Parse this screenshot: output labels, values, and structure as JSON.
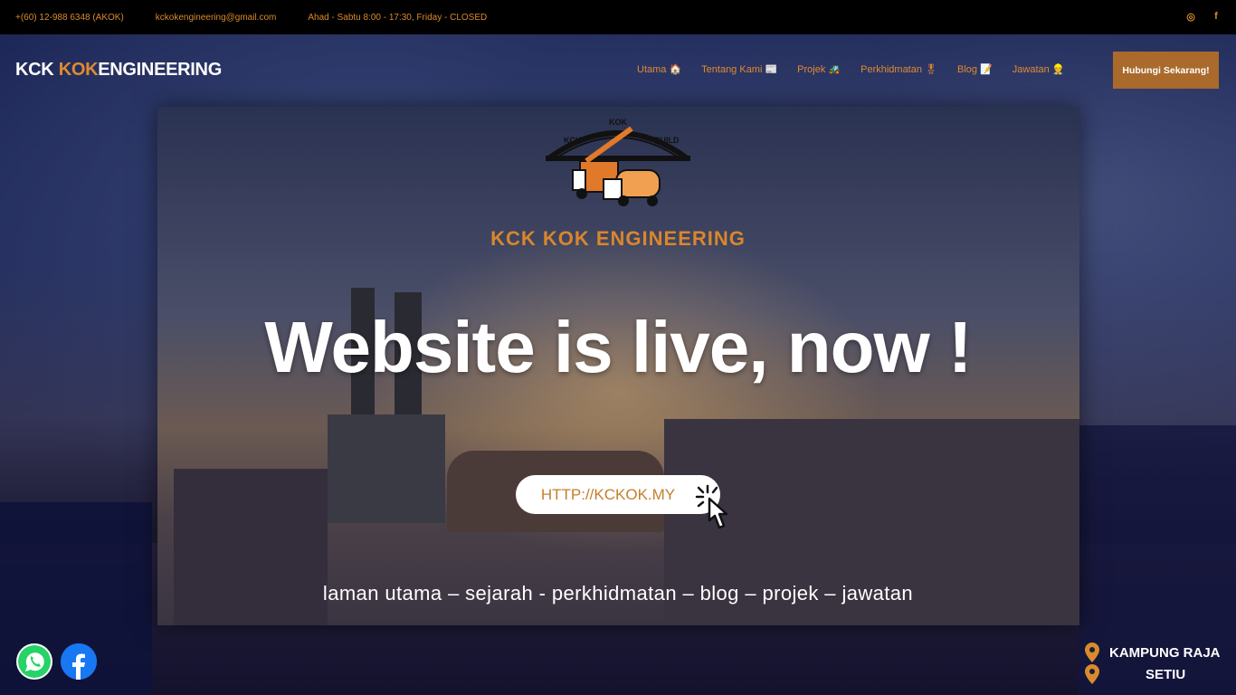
{
  "topbar": {
    "phone": "+(60) 12-988 6348 (AKOK)",
    "email": "kckokengineering@gmail.com",
    "hours": "Ahad - Sabtu 8:00 - 17:30, Friday - CLOSED",
    "social_icons": [
      "instagram-icon",
      "facebook-icon"
    ],
    "instagram_glyph": "◎",
    "facebook_glyph": "f"
  },
  "header": {
    "logo_part1": "KCK ",
    "logo_part2": "KOK",
    "logo_part3": "ENGINEERING",
    "nav": [
      {
        "label": "Utama 🏠"
      },
      {
        "label": "Tentang Kami 📰"
      },
      {
        "label": "Projek 🚜"
      },
      {
        "label": "Perkhidmatan 🎖"
      },
      {
        "label": "Blog 📝"
      },
      {
        "label": "Jawatan 👷"
      }
    ],
    "cta_label": "Hubungi Sekarang!"
  },
  "hero": {
    "brand_logo_text": [
      "KCK",
      "KOK",
      "BUILD"
    ],
    "brand_name": "KCK KOK ENGINEERING",
    "headline": "Website is live, now !",
    "url_button": "HTTP://KCKOK.MY",
    "subnav": "laman utama – sejarah - perkhidmatan – blog – projek – jawatan"
  },
  "floating": {
    "whatsapp_icon": "whatsapp-icon",
    "facebook_icon": "facebook-icon"
  },
  "location": {
    "line1": "KAMPUNG RAJA",
    "line2": "SETIU"
  },
  "colors": {
    "accent": "#e08a2e",
    "cta_bg": "#a96a2c",
    "topbar_bg": "#000000"
  }
}
